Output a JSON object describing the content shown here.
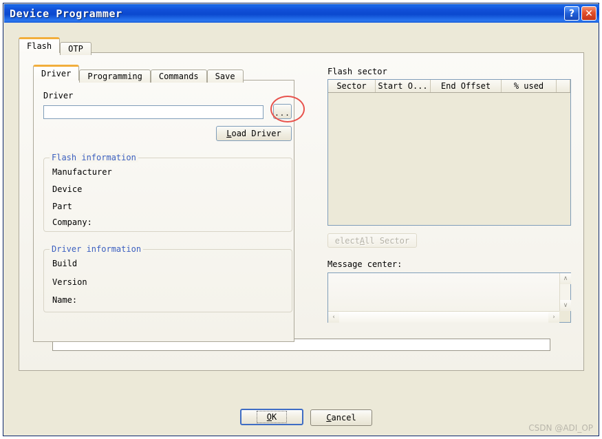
{
  "window": {
    "title": "Device Programmer",
    "help_button": "?",
    "close_button": "✕"
  },
  "outer_tabs": [
    {
      "label": "Flash",
      "active": true
    },
    {
      "label": "OTP",
      "active": false
    }
  ],
  "inner_tabs": [
    {
      "label": "Driver",
      "active": true
    },
    {
      "label": "Programming",
      "active": false
    },
    {
      "label": "Commands",
      "active": false
    },
    {
      "label": "Save",
      "active": false
    }
  ],
  "driver_panel": {
    "driver_label": "Driver",
    "driver_input_value": "",
    "driver_input_placeholder": "",
    "browse_button": "...",
    "load_driver_button": {
      "mnemonic": "L",
      "rest": "oad Driver"
    }
  },
  "flash_information": {
    "legend": "Flash information",
    "rows": [
      "Manufacturer",
      "Device",
      "Part",
      "Company:"
    ]
  },
  "driver_information": {
    "legend": "Driver information",
    "rows": [
      "Build",
      "Version",
      "Name:"
    ]
  },
  "flash_sector": {
    "label": "Flash sector",
    "columns": [
      "Sector",
      "Start O...",
      "End Offset",
      "% used"
    ],
    "rows": [],
    "select_all_button": {
      "pre": "elect ",
      "mnemonic": "A",
      "rest": "ll Sector"
    }
  },
  "message_center": {
    "label": "Message center:",
    "value": "",
    "scroll_up": "∧",
    "scroll_down": "∨",
    "scroll_left": "‹",
    "scroll_right": "›"
  },
  "progress": {
    "value": 0
  },
  "footer": {
    "ok_button": {
      "mnemonic": "O",
      "rest": "K"
    },
    "cancel_button": {
      "pre": "",
      "mnemonic": "C",
      "rest": "ancel"
    }
  },
  "watermark": "CSDN @ADI_OP",
  "colors": {
    "titlebar_blue": "#1150d8",
    "dialog_beige": "#ece9d8",
    "group_legend_blue": "#3b5fc0",
    "active_tab_accent": "#f2ae3c",
    "annotation_red": "#e8524c",
    "close_button_red": "#e2502a"
  }
}
